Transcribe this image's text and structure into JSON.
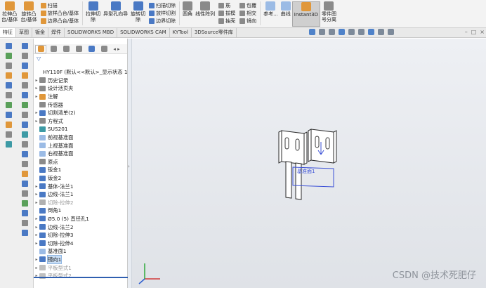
{
  "ribbon": {
    "extrude_boss": "拉伸凸\n台/基体",
    "revolve_boss": "旋转凸\n台/基体",
    "sweep": "扫描",
    "loft": "放样凸台/基体",
    "boundary_boss": "边界凸台/基体",
    "extrude_cut": "拉伸切\n除",
    "hole_wizard": "异型孔向导",
    "revolve_cut": "旋转切\n除",
    "swept_cut": "扫描切除",
    "lofted_cut": "放样切割",
    "boundary_cut": "边界切除",
    "fillet": "圆角",
    "linear_pattern": "线性阵列",
    "rib": "筋",
    "draft": "拔模",
    "shell": "抽壳",
    "wrap": "包覆",
    "intersect": "相交",
    "mirror": "镜向",
    "reference": "参考...",
    "curves": "曲线",
    "instant3d": "Instant3D",
    "part_review": "零件图\n号分离"
  },
  "command_tabs": [
    "特征",
    "草图",
    "钣金",
    "焊件",
    "SOLIDWORKS MBD",
    "SOLIDWORKS CAM",
    "KYTool",
    "3DSource零件库"
  ],
  "active_tab": "特征",
  "tree": {
    "root": "HY110F  (默认<<默认>_显示状态 1>",
    "items": [
      {
        "label": "历史记录",
        "exp": "▸",
        "icon": "history-icon",
        "color": "#8a8a8a",
        "dim": false,
        "sel": false
      },
      {
        "label": "设计活页夹",
        "exp": "▸",
        "icon": "design-binder-icon",
        "color": "#8a8a8a",
        "dim": false,
        "sel": false
      },
      {
        "label": "注解",
        "exp": "▸",
        "icon": "annotations-icon",
        "color": "#e0973a",
        "dim": false,
        "sel": false
      },
      {
        "label": "传感器",
        "exp": "",
        "icon": "sensors-icon",
        "color": "#8a8a8a",
        "dim": false,
        "sel": false
      },
      {
        "label": "切割清单(2)",
        "exp": "▸",
        "icon": "cut-list-icon",
        "color": "#4a79c4",
        "dim": false,
        "sel": false
      },
      {
        "label": "方程式",
        "exp": "▸",
        "icon": "equations-icon",
        "color": "#8a8a8a",
        "dim": false,
        "sel": false
      },
      {
        "label": "SUS201",
        "exp": "",
        "icon": "material-icon",
        "color": "#3d9aa5",
        "dim": false,
        "sel": false
      },
      {
        "label": "前视基准面",
        "exp": "",
        "icon": "plane-icon",
        "color": "#9bbbe5",
        "dim": false,
        "sel": false
      },
      {
        "label": "上视基准面",
        "exp": "",
        "icon": "plane-icon",
        "color": "#9bbbe5",
        "dim": false,
        "sel": false
      },
      {
        "label": "右视基准面",
        "exp": "",
        "icon": "plane-icon",
        "color": "#9bbbe5",
        "dim": false,
        "sel": false
      },
      {
        "label": "原点",
        "exp": "",
        "icon": "origin-icon",
        "color": "#8a8a8a",
        "dim": false,
        "sel": false
      },
      {
        "label": "钣金1",
        "exp": "",
        "icon": "sheet-metal-icon",
        "color": "#4a79c4",
        "dim": false,
        "sel": false
      },
      {
        "label": "钣金2",
        "exp": "",
        "icon": "sheet-metal-icon",
        "color": "#4a79c4",
        "dim": false,
        "sel": false
      },
      {
        "label": "基体-法兰1",
        "exp": "▸",
        "icon": "base-flange-icon",
        "color": "#4a79c4",
        "dim": false,
        "sel": false
      },
      {
        "label": "边线-法兰1",
        "exp": "▸",
        "icon": "edge-flange-icon",
        "color": "#4a79c4",
        "dim": false,
        "sel": false
      },
      {
        "label": "切除-拉伸2",
        "exp": "▸",
        "icon": "extrude-cut-icon",
        "color": "#b0b0b0",
        "dim": true,
        "sel": false
      },
      {
        "label": "倒角1",
        "exp": "",
        "icon": "chamfer-icon",
        "color": "#4a79c4",
        "dim": false,
        "sel": false
      },
      {
        "label": "Ø5.0 (5) 直径孔1",
        "exp": "▸",
        "icon": "hole-icon",
        "color": "#4a79c4",
        "dim": false,
        "sel": false
      },
      {
        "label": "边线-法兰2",
        "exp": "▸",
        "icon": "edge-flange-icon",
        "color": "#4a79c4",
        "dim": false,
        "sel": false
      },
      {
        "label": "切除-拉伸3",
        "exp": "▸",
        "icon": "extrude-cut-icon",
        "color": "#4a79c4",
        "dim": false,
        "sel": false
      },
      {
        "label": "切除-拉伸4",
        "exp": "▸",
        "icon": "extrude-cut-icon",
        "color": "#4a79c4",
        "dim": false,
        "sel": false
      },
      {
        "label": "基准面1",
        "exp": "",
        "icon": "plane-icon",
        "color": "#9bbbe5",
        "dim": false,
        "sel": false
      },
      {
        "label": "镜向1",
        "exp": "▸",
        "icon": "mirror-icon",
        "color": "#4a79c4",
        "dim": false,
        "sel": true
      },
      {
        "label": "平板型式1",
        "exp": "▸",
        "icon": "flat-pattern-icon",
        "color": "#c0c0c0",
        "dim": true,
        "sel": false
      },
      {
        "label": "平板型式2",
        "exp": "▸",
        "icon": "flat-pattern-icon",
        "color": "#c0c0c0",
        "dim": true,
        "sel": false
      }
    ]
  },
  "viewport": {
    "plane_label": "基准面1",
    "model_color": "#ffffff",
    "highlight_color": "#3b50d6"
  },
  "watermark": "CSDN @技术死肥仔"
}
